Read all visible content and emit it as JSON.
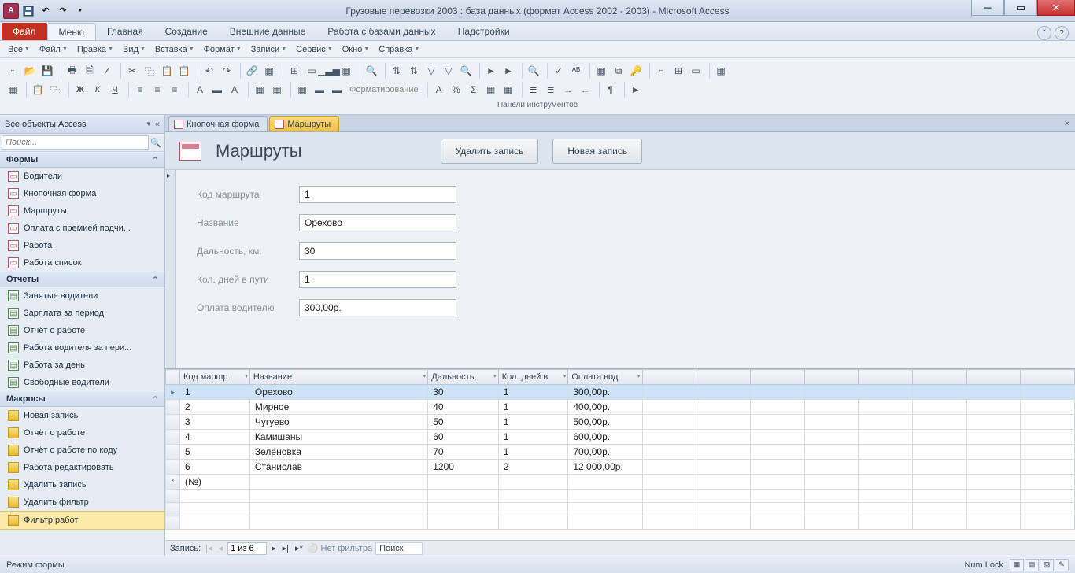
{
  "title": "Грузовые перевозки 2003 : база данных (формат Access 2002 - 2003)  -  Microsoft Access",
  "app_letter": "A",
  "ribbon": {
    "file": "Файл",
    "tabs": [
      "Меню",
      "Главная",
      "Создание",
      "Внешние данные",
      "Работа с базами данных",
      "Надстройки"
    ],
    "active": 0
  },
  "menubar": [
    "Все",
    "Файл",
    "Правка",
    "Вид",
    "Вставка",
    "Формат",
    "Записи",
    "Сервис",
    "Окно",
    "Справка"
  ],
  "toolbar_caption": "Панели инструментов",
  "format_label": "Форматирование",
  "nav": {
    "header": "Все объекты Access",
    "search_placeholder": "Поиск...",
    "groups": [
      {
        "title": "Формы",
        "icon": "form",
        "items": [
          "Водители",
          "Кнопочная форма",
          "Маршруты",
          "Оплата с премией подчи...",
          "Работа",
          "Работа список"
        ]
      },
      {
        "title": "Отчеты",
        "icon": "report",
        "items": [
          "Занятые водители",
          "Зарплата за период",
          "Отчёт о работе",
          "Работа водителя за пери...",
          "Работа за день",
          "Свободные водители"
        ]
      },
      {
        "title": "Макросы",
        "icon": "macro",
        "items": [
          "Новая запись",
          "Отчёт о работе",
          "Отчёт о работе по коду",
          "Работа редактировать",
          "Удалить запись",
          "Удалить фильтр",
          "Фильтр работ"
        ]
      }
    ]
  },
  "doc_tabs": [
    {
      "label": "Кнопочная форма",
      "active": false
    },
    {
      "label": "Маршруты",
      "active": true
    }
  ],
  "form": {
    "title": "Маршруты",
    "buttons": {
      "delete": "Удалить запись",
      "new": "Новая запись"
    },
    "fields": [
      {
        "label": "Код маршрута",
        "value": "1"
      },
      {
        "label": "Название",
        "value": "Орехово"
      },
      {
        "label": "Дальность, км.",
        "value": "30"
      },
      {
        "label": "Кол. дней в пути",
        "value": "1"
      },
      {
        "label": "Оплата водителю",
        "value": "300,00р."
      }
    ]
  },
  "grid": {
    "headers": [
      "Код маршр",
      "Название",
      "Дальность,",
      "Кол. дней в",
      "Оплата вод"
    ],
    "rows": [
      [
        "1",
        "Орехово",
        "30",
        "1",
        "300,00р."
      ],
      [
        "2",
        "Мирное",
        "40",
        "1",
        "400,00р."
      ],
      [
        "3",
        "Чугуево",
        "50",
        "1",
        "500,00р."
      ],
      [
        "4",
        "Камишаны",
        "60",
        "1",
        "600,00р."
      ],
      [
        "5",
        "Зеленовка",
        "70",
        "1",
        "700,00р."
      ],
      [
        "6",
        "Станислав",
        "1200",
        "2",
        "12 000,00р."
      ]
    ],
    "newrow": "(№)"
  },
  "recnav": {
    "label": "Запись:",
    "pos": "1 из 6",
    "nofilter": "Нет фильтра",
    "search": "Поиск"
  },
  "status": {
    "left": "Режим формы",
    "numlock": "Num Lock"
  }
}
